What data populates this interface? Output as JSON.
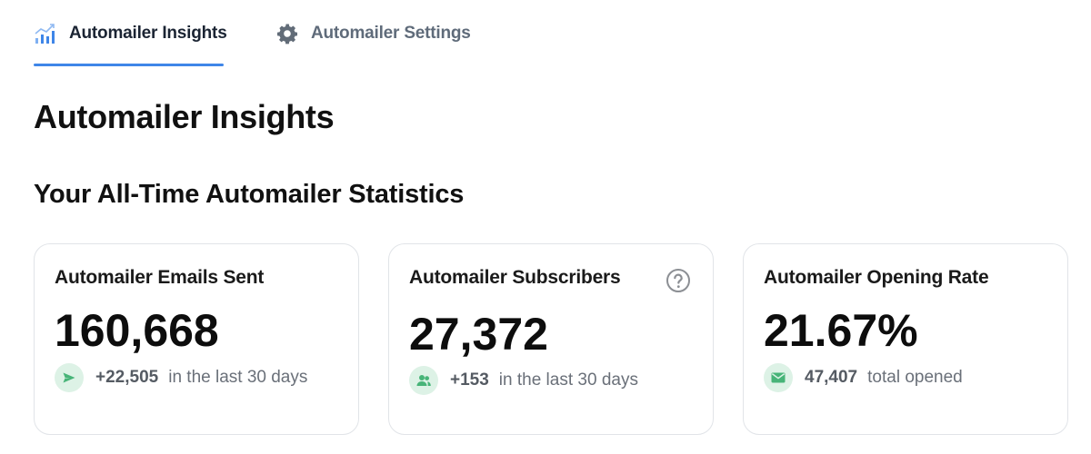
{
  "tabs": [
    {
      "label": "Automailer Insights",
      "icon": "bar-chart-icon",
      "active": true
    },
    {
      "label": "Automailer Settings",
      "icon": "gear-icon",
      "active": false
    }
  ],
  "page": {
    "title": "Automailer Insights",
    "section_title": "Your All-Time Automailer Statistics"
  },
  "cards": [
    {
      "title": "Automailer Emails Sent",
      "value": "160,668",
      "meta_value": "+22,505",
      "meta_text": "in the last 30 days",
      "icon": "send-icon"
    },
    {
      "title": "Automailer Subscribers",
      "value": "27,372",
      "meta_value": "+153",
      "meta_text": "in the last 30 days",
      "icon": "users-icon",
      "help_icon": "help-icon"
    },
    {
      "title": "Automailer Opening Rate",
      "value": "21.67%",
      "meta_value": "47,407",
      "meta_text": "total opened",
      "icon": "envelope-icon"
    }
  ],
  "colors": {
    "accent": "#3f86e8",
    "icon_green": "#47b478",
    "icon_green_bg": "#ddf2e6",
    "muted_text": "#6a7079",
    "border": "#e1e4e8"
  }
}
